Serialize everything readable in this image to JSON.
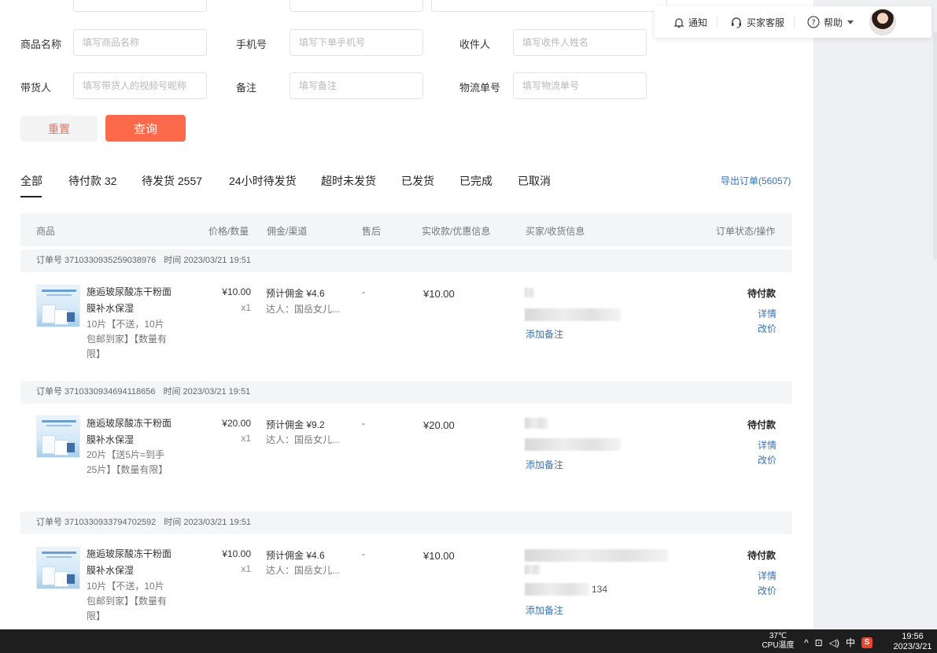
{
  "header": {
    "notify_label": "通知",
    "service_label": "买家客服",
    "help_label": "帮助"
  },
  "filters": {
    "product_name": {
      "label": "商品名称",
      "placeholder": "填写商品名称"
    },
    "phone": {
      "label": "手机号",
      "placeholder": "填写下单手机号"
    },
    "receiver": {
      "label": "收件人",
      "placeholder": "填写收件人姓名"
    },
    "promoter": {
      "label": "带货人",
      "placeholder": "填写带货人的视频号昵称"
    },
    "remark": {
      "label": "备注",
      "placeholder": "填写备注"
    },
    "tracking": {
      "label": "物流单号",
      "placeholder": "填写物流单号"
    },
    "reset_label": "重置",
    "query_label": "查询"
  },
  "tabs": [
    "全部",
    "待付款 32",
    "待发货 2557",
    "24小时待发货",
    "超时未发货",
    "已发货",
    "已完成",
    "已取消"
  ],
  "export_label": "导出订单(56057)",
  "table_headers": {
    "product": "商品",
    "price_qty": "价格/数量",
    "commission": "佣金/渠道",
    "after_sale": "售后",
    "paid": "实收款/优惠信息",
    "buyer": "买家/收货信息",
    "status": "订单状态/操作"
  },
  "orders": [
    {
      "order_no": "订单号 3710330935259038976",
      "time": "时间 2023/03/21 19:51",
      "product_name": "施逅玻尿酸冻干粉面膜补水保湿",
      "spec": "10片【不送，10片包邮到家】【数量有限】",
      "price": "¥10.00",
      "qty": "x1",
      "commission": "预计佣金 ¥4.6",
      "talent": "达人：国岳女儿...",
      "after_sale": "-",
      "paid": "¥10.00",
      "buyer_fragment_1": "",
      "buyer_fragment_2": "",
      "note_label": "添加备注",
      "status": "待付款",
      "detail_label": "详情",
      "reprice_label": "改价"
    },
    {
      "order_no": "订单号 3710330934694118656",
      "time": "时间 2023/03/21 19:51",
      "product_name": "施逅玻尿酸冻干粉面膜补水保湿",
      "spec": "20片【送5片=到手25片】【数量有限】",
      "price": "¥20.00",
      "qty": "x1",
      "commission": "预计佣金 ¥9.2",
      "talent": "达人：国岳女儿...",
      "after_sale": "-",
      "paid": "¥20.00",
      "buyer_fragment_1": "",
      "buyer_fragment_2": "",
      "note_label": "添加备注",
      "status": "待付款",
      "detail_label": "详情",
      "reprice_label": "改价"
    },
    {
      "order_no": "订单号 3710330933794702592",
      "time": "时间 2023/03/21 19:51",
      "product_name": "施逅玻尿酸冻干粉面膜补水保湿",
      "spec": "10片【不送，10片包邮到家】【数量有限】",
      "price": "¥10.00",
      "qty": "x1",
      "commission": "预计佣金 ¥4.6",
      "talent": "达人：国岳女儿...",
      "after_sale": "-",
      "paid": "¥10.00",
      "buyer_fragment_1": "",
      "buyer_fragment_2": "134",
      "note_label": "添加备注",
      "status": "待付款",
      "detail_label": "详情",
      "reprice_label": "改价"
    }
  ],
  "taskbar": {
    "temp": "37℃",
    "temp_label": "CPU温度",
    "ime": "中",
    "time": "19:56",
    "date": "2023/3/21"
  },
  "colors": {
    "accent": "#fd6a4b",
    "link": "#3a73b8",
    "header_bg": "#f4f5f7"
  }
}
